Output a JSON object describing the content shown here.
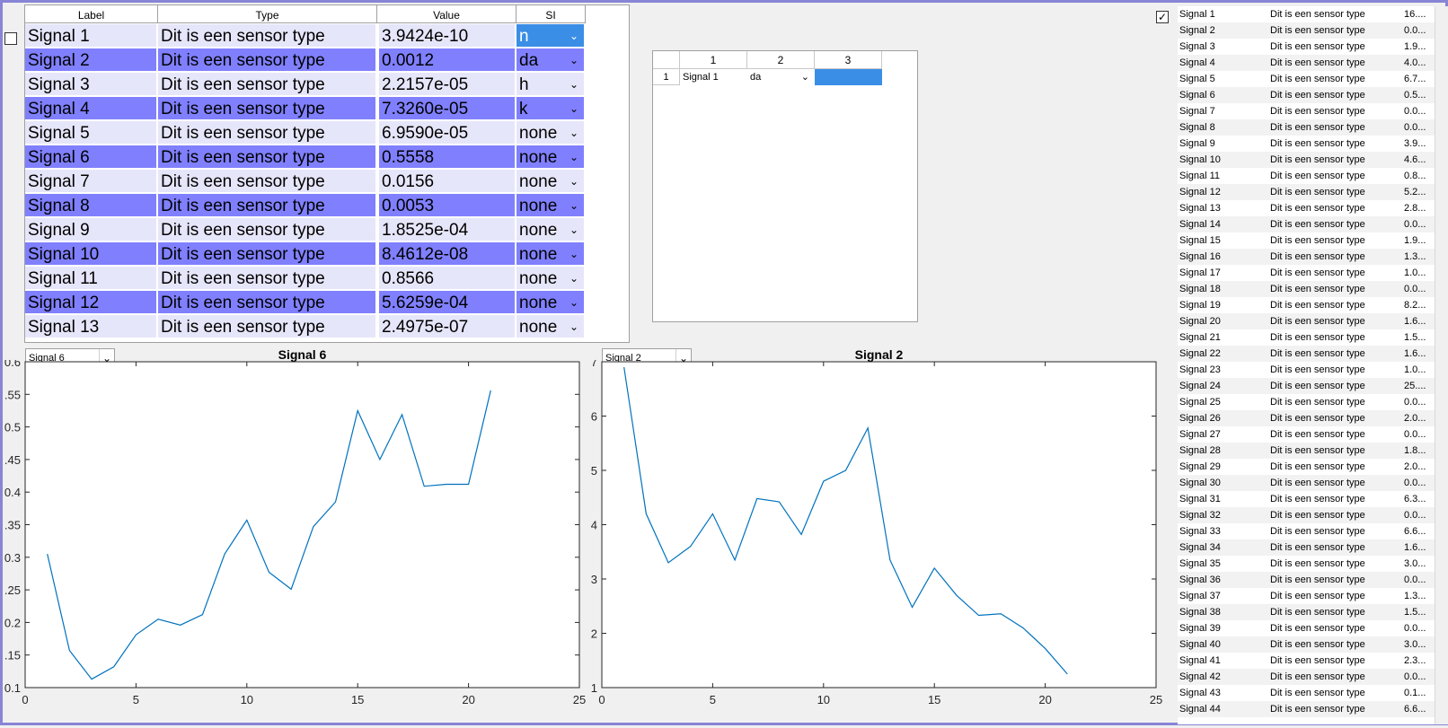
{
  "main_table": {
    "headers": [
      "Label",
      "Type",
      "Value",
      "SI"
    ],
    "rows": [
      {
        "label": "Signal 1",
        "type": "Dit is een sensor type",
        "value": "3.9424e-10",
        "si": "n"
      },
      {
        "label": "Signal 2",
        "type": "Dit is een sensor type",
        "value": "0.0012",
        "si": "da"
      },
      {
        "label": "Signal 3",
        "type": "Dit is een sensor type",
        "value": "2.2157e-05",
        "si": "h"
      },
      {
        "label": "Signal 4",
        "type": "Dit is een sensor type",
        "value": "7.3260e-05",
        "si": "k"
      },
      {
        "label": "Signal 5",
        "type": "Dit is een sensor type",
        "value": "6.9590e-05",
        "si": "none"
      },
      {
        "label": "Signal 6",
        "type": "Dit is een sensor type",
        "value": "0.5558",
        "si": "none"
      },
      {
        "label": "Signal 7",
        "type": "Dit is een sensor type",
        "value": "0.0156",
        "si": "none"
      },
      {
        "label": "Signal 8",
        "type": "Dit is een sensor type",
        "value": "0.0053",
        "si": "none"
      },
      {
        "label": "Signal 9",
        "type": "Dit is een sensor type",
        "value": "1.8525e-04",
        "si": "none"
      },
      {
        "label": "Signal 10",
        "type": "Dit is een sensor type",
        "value": "8.4612e-08",
        "si": "none"
      },
      {
        "label": "Signal 11",
        "type": "Dit is een sensor type",
        "value": "0.8566",
        "si": "none"
      },
      {
        "label": "Signal 12",
        "type": "Dit is een sensor type",
        "value": "5.6259e-04",
        "si": "none"
      },
      {
        "label": "Signal 13",
        "type": "Dit is een sensor type",
        "value": "2.4975e-07",
        "si": "none"
      }
    ]
  },
  "small_table": {
    "col_headers": [
      "1",
      "2",
      "3"
    ],
    "row_headers": [
      "1"
    ],
    "cells": [
      "Signal 1",
      "da",
      ""
    ]
  },
  "left_plot": {
    "dropdown": "Signal 6",
    "title": "Signal 6"
  },
  "right_plot": {
    "dropdown": "Signal 2",
    "title": "Signal 2"
  },
  "chart_data": [
    {
      "type": "line",
      "title": "Signal 6",
      "x": [
        1,
        2,
        3,
        4,
        5,
        6,
        7,
        8,
        9,
        10,
        11,
        12,
        13,
        14,
        15,
        16,
        17,
        18,
        19,
        20,
        21
      ],
      "series": [
        {
          "values": [
            0.305,
            0.157,
            0.113,
            0.132,
            0.181,
            0.205,
            0.196,
            0.212,
            0.305,
            0.357,
            0.277,
            0.251,
            0.347,
            0.385,
            0.525,
            0.45,
            0.519,
            0.409,
            0.412,
            0.412,
            0.556
          ]
        }
      ],
      "xlim": [
        0,
        25
      ],
      "ylim": [
        0.1,
        0.6
      ],
      "xticks": [
        "0",
        "5",
        "10",
        "15",
        "20",
        "25"
      ],
      "yticks": [
        "0.1",
        ".15",
        "0.2",
        ".25",
        "0.3",
        ".35",
        "0.4",
        ".45",
        "0.5",
        ".55",
        "0.6"
      ],
      "color": "#0072bd"
    },
    {
      "type": "line",
      "title": "Signal 2",
      "x": [
        1,
        2,
        3,
        4,
        5,
        6,
        7,
        8,
        9,
        10,
        11,
        12,
        13,
        14,
        15,
        16,
        17,
        18,
        19,
        20,
        21
      ],
      "series": [
        {
          "values": [
            6.9,
            4.2,
            3.3,
            3.6,
            4.2,
            3.35,
            4.48,
            4.42,
            3.82,
            4.8,
            5.0,
            5.78,
            3.35,
            2.48,
            3.2,
            2.7,
            2.33,
            2.36,
            2.1,
            1.72,
            1.25
          ]
        }
      ],
      "xlim": [
        0,
        25
      ],
      "ylim": [
        1,
        7
      ],
      "xticks": [
        "0",
        "5",
        "10",
        "15",
        "20",
        "25"
      ],
      "yticks": [
        "1",
        "2",
        "3",
        "4",
        "5",
        "6",
        "7"
      ],
      "color": "#0072bd"
    }
  ],
  "right_list": {
    "rows": [
      {
        "label": "Signal 1",
        "type": "Dit is een sensor type",
        "value": "16...."
      },
      {
        "label": "Signal 2",
        "type": "Dit is een sensor type",
        "value": "0.0..."
      },
      {
        "label": "Signal 3",
        "type": "Dit is een sensor type",
        "value": "1.9..."
      },
      {
        "label": "Signal 4",
        "type": "Dit is een sensor type",
        "value": "4.0..."
      },
      {
        "label": "Signal 5",
        "type": "Dit is een sensor type",
        "value": "6.7..."
      },
      {
        "label": "Signal 6",
        "type": "Dit is een sensor type",
        "value": "0.5..."
      },
      {
        "label": "Signal 7",
        "type": "Dit is een sensor type",
        "value": "0.0..."
      },
      {
        "label": "Signal 8",
        "type": "Dit is een sensor type",
        "value": "0.0..."
      },
      {
        "label": "Signal 9",
        "type": "Dit is een sensor type",
        "value": "3.9..."
      },
      {
        "label": "Signal 10",
        "type": "Dit is een sensor type",
        "value": "4.6..."
      },
      {
        "label": "Signal 11",
        "type": "Dit is een sensor type",
        "value": "0.8..."
      },
      {
        "label": "Signal 12",
        "type": "Dit is een sensor type",
        "value": "5.2..."
      },
      {
        "label": "Signal 13",
        "type": "Dit is een sensor type",
        "value": "2.8..."
      },
      {
        "label": "Signal 14",
        "type": "Dit is een sensor type",
        "value": "0.0..."
      },
      {
        "label": "Signal 15",
        "type": "Dit is een sensor type",
        "value": "1.9..."
      },
      {
        "label": "Signal 16",
        "type": "Dit is een sensor type",
        "value": "1.3..."
      },
      {
        "label": "Signal 17",
        "type": "Dit is een sensor type",
        "value": "1.0..."
      },
      {
        "label": "Signal 18",
        "type": "Dit is een sensor type",
        "value": "0.0..."
      },
      {
        "label": "Signal 19",
        "type": "Dit is een sensor type",
        "value": "8.2..."
      },
      {
        "label": "Signal 20",
        "type": "Dit is een sensor type",
        "value": "1.6..."
      },
      {
        "label": "Signal 21",
        "type": "Dit is een sensor type",
        "value": "1.5..."
      },
      {
        "label": "Signal 22",
        "type": "Dit is een sensor type",
        "value": "1.6..."
      },
      {
        "label": "Signal 23",
        "type": "Dit is een sensor type",
        "value": "1.0..."
      },
      {
        "label": "Signal 24",
        "type": "Dit is een sensor type",
        "value": "25...."
      },
      {
        "label": "Signal 25",
        "type": "Dit is een sensor type",
        "value": "0.0..."
      },
      {
        "label": "Signal 26",
        "type": "Dit is een sensor type",
        "value": "2.0..."
      },
      {
        "label": "Signal 27",
        "type": "Dit is een sensor type",
        "value": "0.0..."
      },
      {
        "label": "Signal 28",
        "type": "Dit is een sensor type",
        "value": "1.8..."
      },
      {
        "label": "Signal 29",
        "type": "Dit is een sensor type",
        "value": "2.0..."
      },
      {
        "label": "Signal 30",
        "type": "Dit is een sensor type",
        "value": "0.0..."
      },
      {
        "label": "Signal 31",
        "type": "Dit is een sensor type",
        "value": "6.3..."
      },
      {
        "label": "Signal 32",
        "type": "Dit is een sensor type",
        "value": "0.0..."
      },
      {
        "label": "Signal 33",
        "type": "Dit is een sensor type",
        "value": "6.6..."
      },
      {
        "label": "Signal 34",
        "type": "Dit is een sensor type",
        "value": "1.6..."
      },
      {
        "label": "Signal 35",
        "type": "Dit is een sensor type",
        "value": "3.0..."
      },
      {
        "label": "Signal 36",
        "type": "Dit is een sensor type",
        "value": "0.0..."
      },
      {
        "label": "Signal 37",
        "type": "Dit is een sensor type",
        "value": "1.3..."
      },
      {
        "label": "Signal 38",
        "type": "Dit is een sensor type",
        "value": "1.5..."
      },
      {
        "label": "Signal 39",
        "type": "Dit is een sensor type",
        "value": "0.0..."
      },
      {
        "label": "Signal 40",
        "type": "Dit is een sensor type",
        "value": "3.0..."
      },
      {
        "label": "Signal 41",
        "type": "Dit is een sensor type",
        "value": "2.3..."
      },
      {
        "label": "Signal 42",
        "type": "Dit is een sensor type",
        "value": "0.0..."
      },
      {
        "label": "Signal 43",
        "type": "Dit is een sensor type",
        "value": "0.1..."
      },
      {
        "label": "Signal 44",
        "type": "Dit is een sensor type",
        "value": "6.6..."
      }
    ]
  },
  "checkbox_left_checked": false,
  "checkbox_right_checked": true,
  "colors": {
    "row_light": "#e6e6fa",
    "row_dark": "#8080ff",
    "selection": "#3a8ee6",
    "line": "#0072bd",
    "border": "#8884d6"
  }
}
